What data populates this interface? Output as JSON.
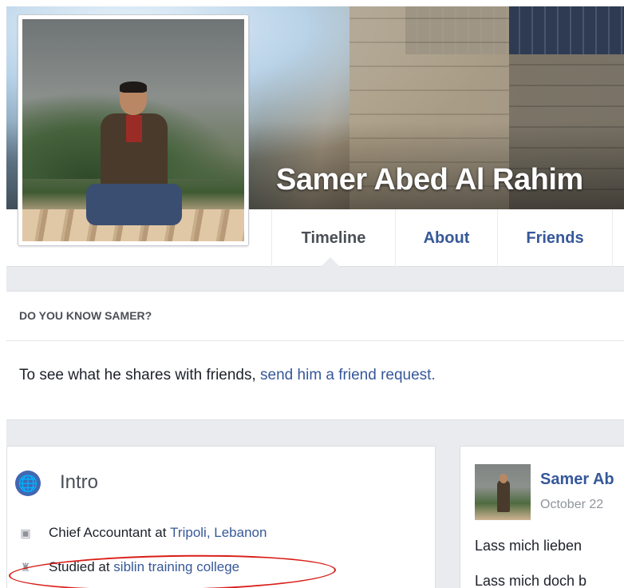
{
  "profile": {
    "name": "Samer Abed Al Rahim"
  },
  "tabs": [
    {
      "label": "Timeline",
      "active": true
    },
    {
      "label": "About",
      "active": false
    },
    {
      "label": "Friends",
      "active": false
    }
  ],
  "know_box": {
    "heading": "DO YOU KNOW SAMER?",
    "text": "To see what he shares with friends, ",
    "link": "send him a friend request."
  },
  "intro": {
    "title": "Intro",
    "icon": "globe-icon",
    "work": {
      "prefix": "Chief Accountant at ",
      "link": "Tripoli, Lebanon",
      "icon": "briefcase-icon"
    },
    "education": {
      "prefix": "Studied at ",
      "link": "siblin training college",
      "icon": "graduation-cap-icon"
    },
    "highlight_color": "#d91e18"
  },
  "post": {
    "author": "Samer Ab",
    "date": "October 22",
    "line1": "Lass mich lieben",
    "line2": "Lass mich doch b"
  },
  "colors": {
    "link": "#365899",
    "background": "#e9ebee",
    "brand": "#4267b2"
  }
}
